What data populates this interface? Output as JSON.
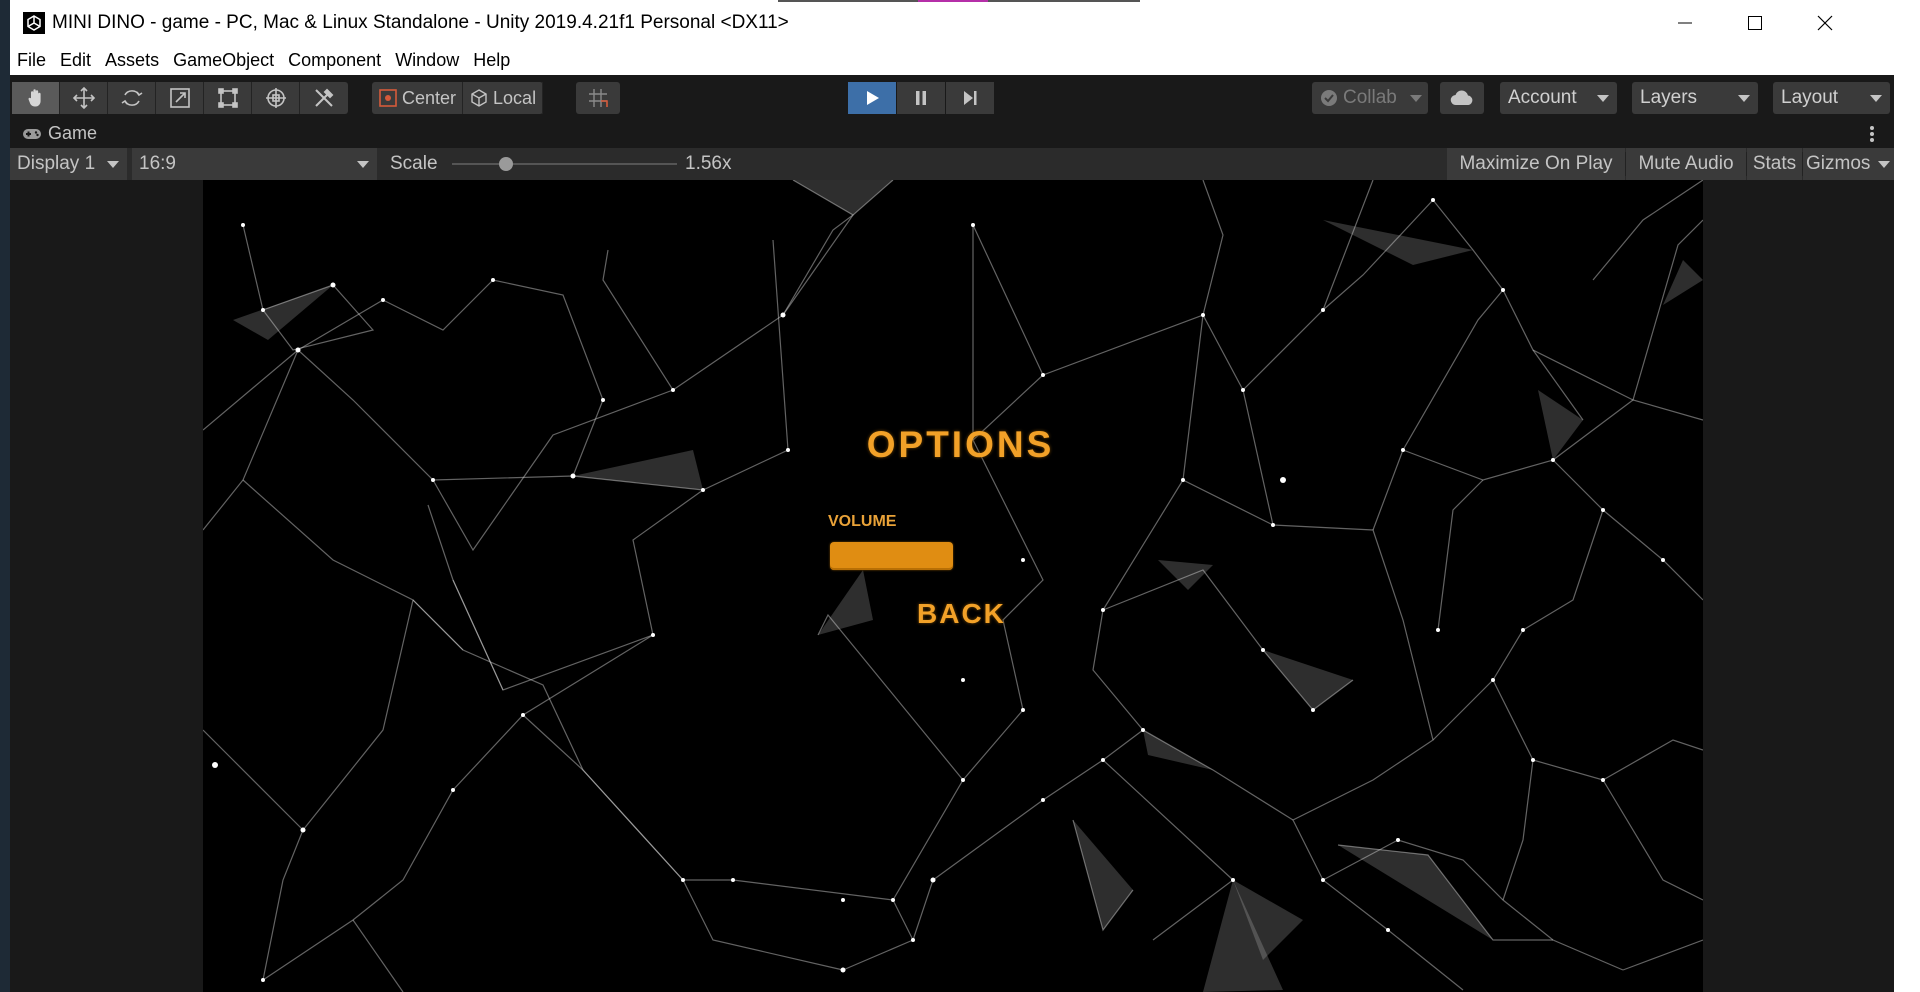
{
  "window": {
    "title": "MINI DINO - game - PC, Mac & Linux Standalone - Unity 2019.4.21f1 Personal <DX11>"
  },
  "menu": [
    "File",
    "Edit",
    "Assets",
    "GameObject",
    "Component",
    "Window",
    "Help"
  ],
  "toolbar": {
    "tools": [
      "hand-tool-icon",
      "move-tool-icon",
      "rotate-tool-icon",
      "scale-tool-icon",
      "rect-tool-icon",
      "transform-tool-icon",
      "custom-tool-icon"
    ],
    "pivot_label": "Center",
    "pivot_rotation_label": "Local",
    "collab_label": "Collab",
    "account_label": "Account",
    "layers_label": "Layers",
    "layout_label": "Layout"
  },
  "game_panel": {
    "tab_label": "Game",
    "display_label": "Display 1",
    "aspect_label": "16:9",
    "scale_label": "Scale",
    "scale_value": "1.56x",
    "scale_slider_fraction": 0.24,
    "maximize_label": "Maximize On Play",
    "mute_label": "Mute Audio",
    "stats_label": "Stats",
    "gizmos_label": "Gizmos"
  },
  "game": {
    "title": "OPTIONS",
    "volume_label": "VOLUME",
    "back_label": "BACK"
  },
  "colors": {
    "accent_play": "#3d6fa8",
    "game_text": "#f2a128",
    "slider_fill": "#e08d12"
  }
}
